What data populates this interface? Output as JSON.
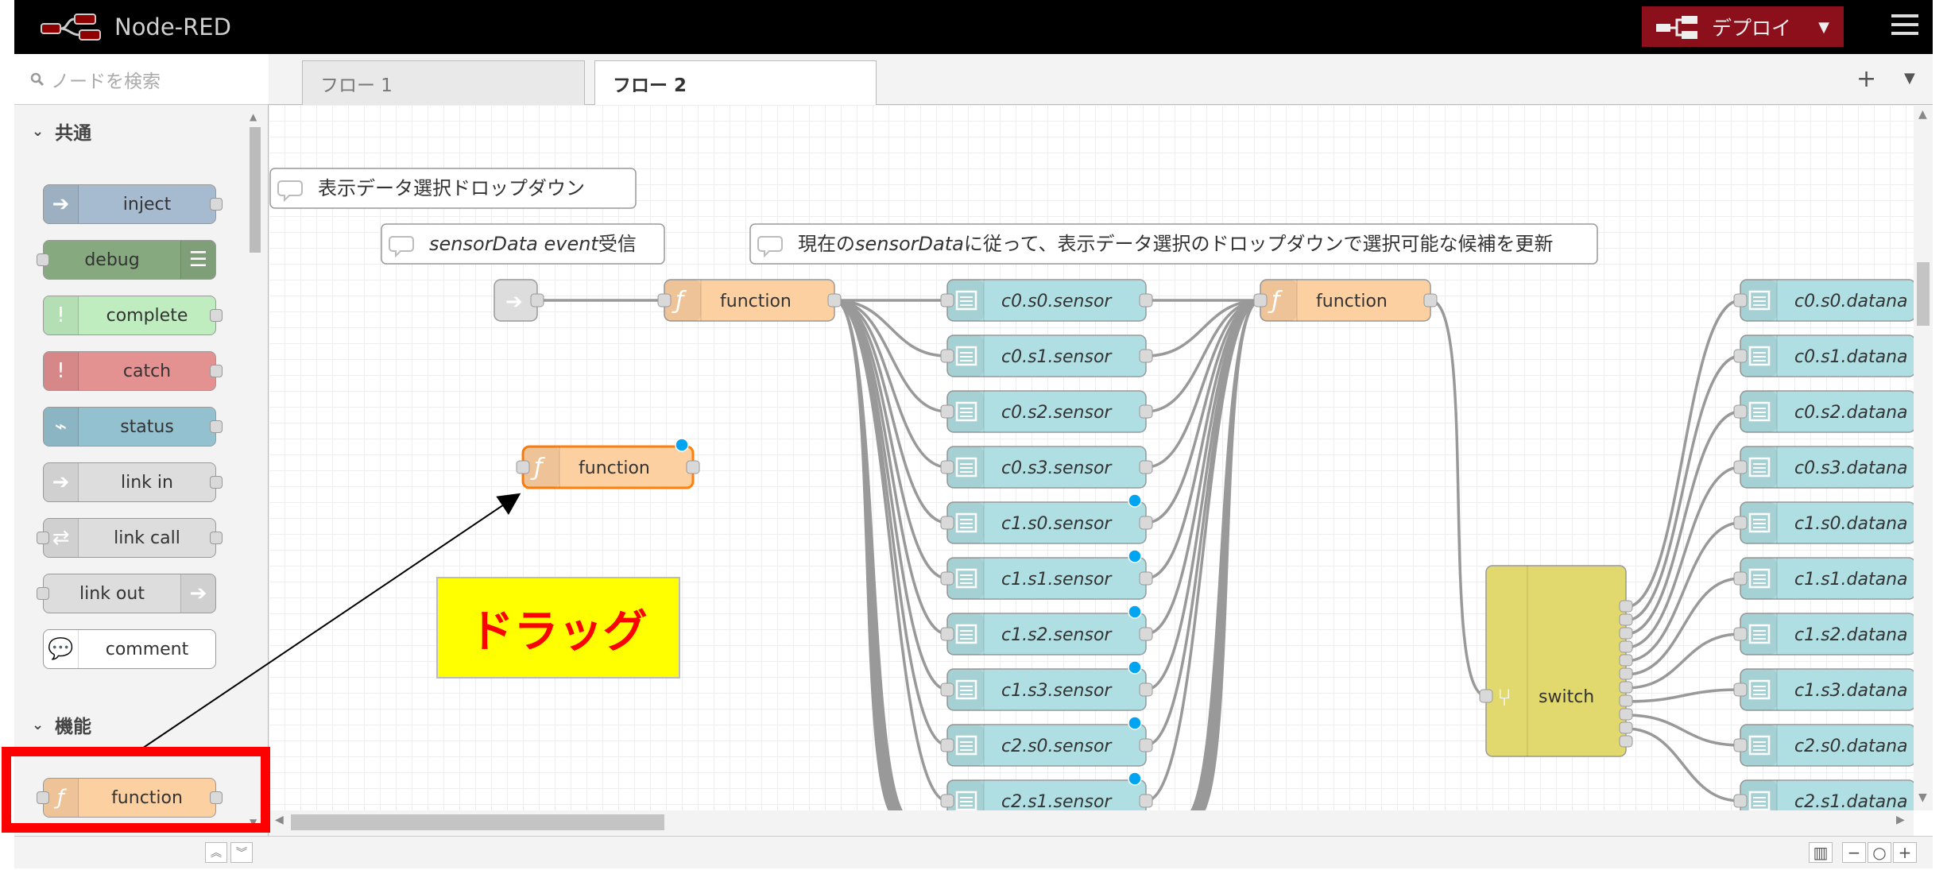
{
  "app": {
    "title": "Node-RED",
    "deploy_label": "デプロイ"
  },
  "palette": {
    "search_placeholder": "ノードを検索",
    "categories": [
      {
        "name": "共通",
        "nodes": [
          {
            "label": "inject",
            "color": "#a6bbcf"
          },
          {
            "label": "debug",
            "color": "#87a980"
          },
          {
            "label": "complete",
            "color": "#c0edc0"
          },
          {
            "label": "catch",
            "color": "#e49191"
          },
          {
            "label": "status",
            "color": "#94c1d0"
          },
          {
            "label": "link in",
            "color": "#dddddd"
          },
          {
            "label": "link call",
            "color": "#dddddd"
          },
          {
            "label": "link out",
            "color": "#dddddd"
          },
          {
            "label": "comment",
            "color": "#ffffff"
          }
        ]
      },
      {
        "name": "機能",
        "nodes": [
          {
            "label": "function",
            "color": "#fdd0a2"
          }
        ]
      }
    ]
  },
  "tabs": [
    {
      "label": "フロー 1",
      "active": false
    },
    {
      "label": "フロー 2",
      "active": true
    }
  ],
  "flow": {
    "comments": [
      {
        "text": "表示データ選択ドロップダウン"
      },
      {
        "text_italic": "sensorData event",
        "text": "受信"
      },
      {
        "prefix": "現在の",
        "text_italic": "sensorData",
        "text": "に従って、表示データ選択のドロップダウンで選択可能な候補を更新"
      }
    ],
    "function_label": "function",
    "sensor_nodes": [
      "c0.s0.sensor",
      "c0.s1.sensor",
      "c0.s2.sensor",
      "c0.s3.sensor",
      "c1.s0.sensor",
      "c1.s1.sensor",
      "c1.s2.sensor",
      "c1.s3.sensor",
      "c2.s0.sensor",
      "c2.s1.sensor"
    ],
    "datana_nodes": [
      "c0.s0.datana",
      "c0.s1.datana",
      "c0.s2.datana",
      "c0.s3.datana",
      "c1.s0.datana",
      "c1.s1.datana",
      "c1.s2.datana",
      "c1.s3.datana",
      "c2.s0.datana",
      "c2.s1.datana"
    ],
    "switch_label": "switch",
    "colors": {
      "function": "#fdd0a2",
      "sensor": "#b0dfe3",
      "switch": "#e2d96e",
      "changed": "#ff7f0e",
      "badge": "#00a4f0"
    }
  },
  "annotation": {
    "drag_label": "ドラッグ"
  }
}
